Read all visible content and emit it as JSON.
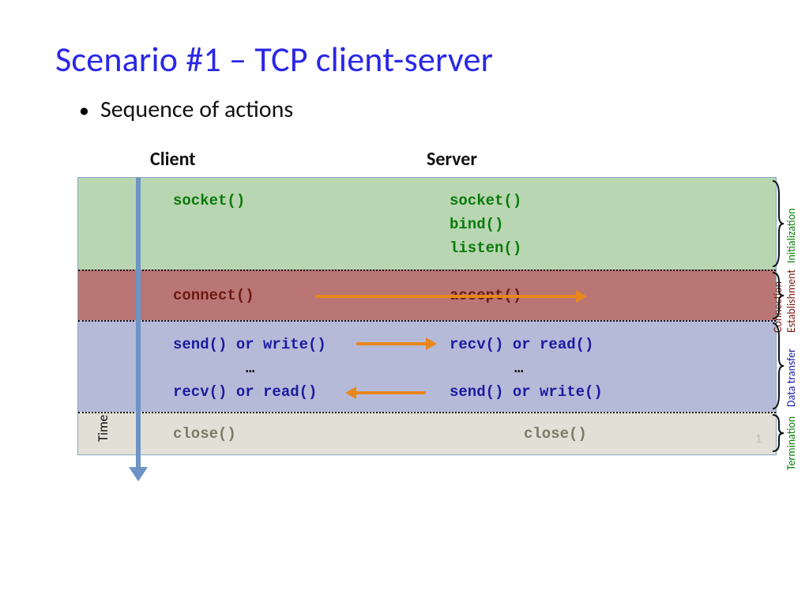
{
  "title": "Scenario #1 – TCP client-server",
  "bullet": "Sequence of actions",
  "cols": {
    "client": "Client",
    "server": "Server"
  },
  "init": {
    "client": [
      "socket()"
    ],
    "server": [
      "socket()",
      "bind()",
      "listen()"
    ]
  },
  "est": {
    "client": "connect()",
    "server": "accept()"
  },
  "data": {
    "c1": "send() or write()",
    "s1": "recv() or read()",
    "ellipsis": "…",
    "c2": "recv() or read()",
    "s2": "send() or write()"
  },
  "term": {
    "client": "close()",
    "server": "close()"
  },
  "time_label": "Time",
  "phases": {
    "init": "Initialization",
    "est": "Connection Establishment",
    "data": "Data transfer",
    "term": "Termination"
  },
  "slide_number": "1"
}
